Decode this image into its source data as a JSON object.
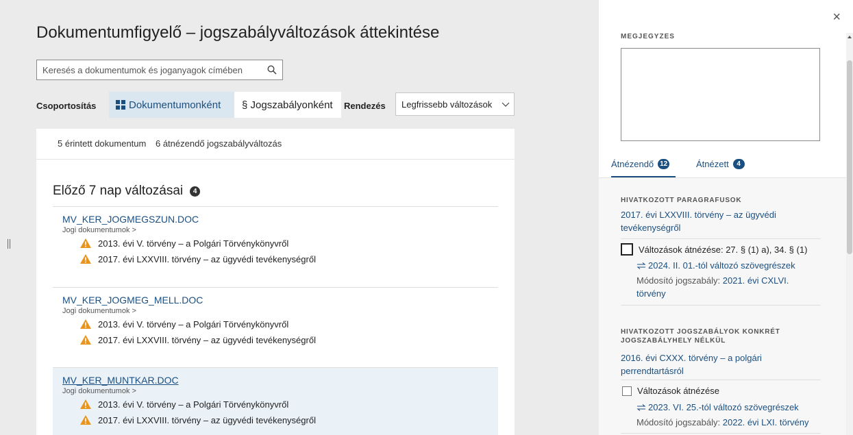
{
  "page": {
    "title": "Dokumentumfigyelő – jogszabályváltozások áttekintése"
  },
  "search": {
    "placeholder": "Keresés a dokumentumok és joganyagok címében"
  },
  "grouping": {
    "label": "Csoportosítás",
    "by_document": "Dokumentumonként",
    "by_law": "§ Jogszabályonként"
  },
  "sorting": {
    "label": "Rendezés",
    "selected": "Legfrissebb változások"
  },
  "summary": {
    "documents": "5 érintett dokumentum",
    "changes": "6 átnézendő jogszabályváltozás"
  },
  "section": {
    "title": "Előző 7 nap változásai",
    "count": "4"
  },
  "documents": [
    {
      "name": "MV_KER_JOGMEGSZUN.DOC",
      "path": "Jogi dokumentumok >",
      "laws": [
        "2013. évi V. törvény – a Polgári Törvénykönyvről",
        "2017. évi LXXVIII. törvény – az ügyvédi tevékenységről"
      ]
    },
    {
      "name": "MV_KER_JOGMEG_MELL.DOC",
      "path": "Jogi dokumentumok >",
      "laws": [
        "2013. évi V. törvény – a Polgári Törvénykönyvről",
        "2017. évi LXXVIII. törvény – az ügyvédi tevékenységről"
      ]
    },
    {
      "name": "MV_KER_MUNTKAR.DOC",
      "path": "Jogi dokumentumok >",
      "laws": [
        "2013. évi V. törvény – a Polgári Törvénykönyvről",
        "2017. évi LXXVIII. törvény – az ügyvédi tevékenységről"
      ]
    }
  ],
  "side": {
    "close": "×",
    "note_label": "MEGJEGYZES",
    "tabs": [
      {
        "label": "Átnézendő",
        "count": "12"
      },
      {
        "label": "Átnézett",
        "count": "4"
      }
    ],
    "groups": [
      {
        "category": "HIVATKOZOTT PARAGRAFUSOK",
        "law": "2017. évi LXXVIII. törvény – az ügyvédi tevékenységről",
        "check_label": "Változások átnézése: 27. § (1) a), 34. § (1)",
        "change": "2024. II. 01.-tól változó szövegrészek",
        "mod_prefix": "Módosító jogszabály:",
        "mod_law": "2021. évi CXLVI. törvény"
      },
      {
        "category": "HIVATKOZOTT JOGSZABÁLYOK KONKRÉT JOGSZABÁLYHELY NÉLKÜL",
        "law": "2016. évi CXXX. törvény – a polgári perrendtartásról",
        "check_label": "Változások átnézése",
        "change": "2023. VI. 25.-tól változó szövegrészek",
        "mod_prefix": "Módosító jogszabály:",
        "mod_law": "2022. évi LXI. törvény"
      }
    ]
  },
  "colors": {
    "accent": "#1b4f80",
    "warning": "#e8951f",
    "selected_bg": "#dbe7f0"
  }
}
